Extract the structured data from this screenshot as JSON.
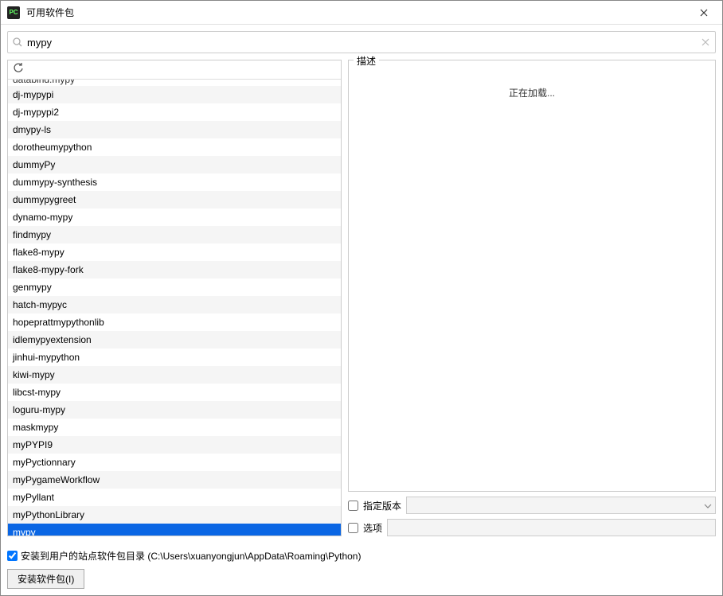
{
  "window": {
    "title": "可用软件包",
    "app_icon_text": "PC"
  },
  "search": {
    "value": "mypy"
  },
  "packages_partial_top": "databind.mypy",
  "packages": [
    "dj-mypypi",
    "dj-mypypi2",
    "dmypy-ls",
    "dorotheumypython",
    "dummyPy",
    "dummypy-synthesis",
    "dummypygreet",
    "dynamo-mypy",
    "findmypy",
    "flake8-mypy",
    "flake8-mypy-fork",
    "genmypy",
    "hatch-mypyc",
    "hopeprattmypythonlib",
    "idlemypyextension",
    "jinhui-mypython",
    "kiwi-mypy",
    "libcst-mypy",
    "loguru-mypy",
    "maskmypy",
    "myPYPI9",
    "myPyctionnary",
    "myPygameWorkflow",
    "myPyllant",
    "myPythonLibrary",
    "mypy"
  ],
  "selected_package": "mypy",
  "description": {
    "label": "描述",
    "loading_text": "正在加载..."
  },
  "options": {
    "specify_version_label": "指定版本",
    "specify_version_checked": false,
    "version_value": "",
    "options_label": "选项",
    "options_checked": false,
    "options_value": ""
  },
  "install_to_user_site": {
    "checked": true,
    "label": "安装到用户的站点软件包目录 (C:\\Users\\xuanyongjun\\AppData\\Roaming\\Python)"
  },
  "install_button_label": "安装软件包(I)"
}
